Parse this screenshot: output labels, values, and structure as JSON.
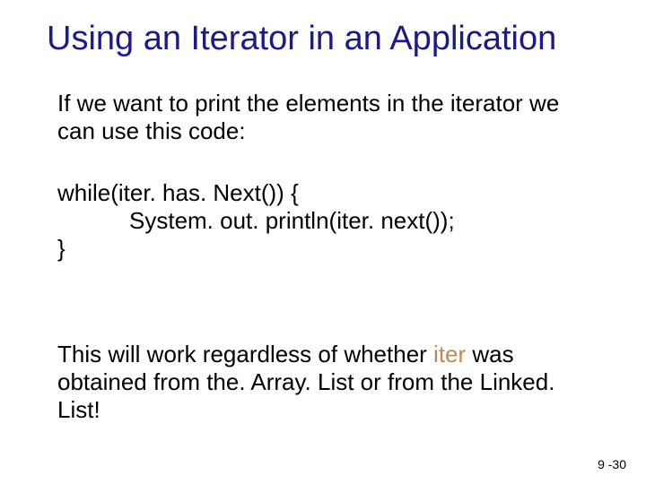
{
  "title": "Using an Iterator in an Application",
  "intro": "If we want to print the elements in the iterator we can use this code:",
  "code": {
    "line1": "while(iter. has. Next()) {",
    "line2_indent": "",
    "line2": "System. out. println(iter. next());",
    "line3": "}"
  },
  "outro": {
    "part1": "This will work regardless of whether ",
    "hilite": "iter",
    "part2": " was obtained from the. Array. List or from the Linked. List!"
  },
  "page_number": "9 -30"
}
